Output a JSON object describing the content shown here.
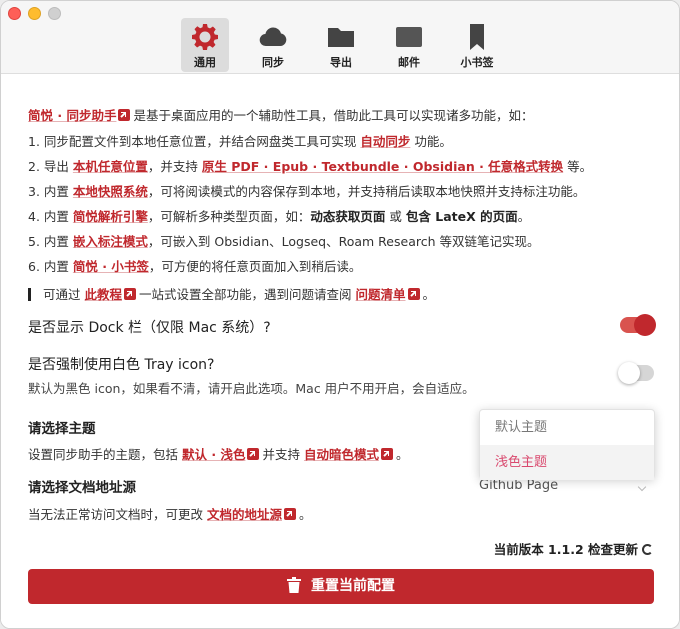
{
  "tabs": [
    {
      "label": "通用",
      "icon": "gear-icon",
      "active": true
    },
    {
      "label": "同步",
      "icon": "cloud-icon"
    },
    {
      "label": "导出",
      "icon": "folder-icon"
    },
    {
      "label": "邮件",
      "icon": "mail-icon"
    },
    {
      "label": "小书签",
      "icon": "bookmark-icon"
    }
  ],
  "intro": {
    "app_name": "简悦 · 同步助手",
    "lead": "是基于桌面应用的一个辅助性工具，借助此工具可以实现诸多功能，如：",
    "l1a": "1. 同步配置文件到本地任意位置，并结合网盘类工具可实现",
    "l1b": "自动同步",
    "l1c": "功能。",
    "l2a": "2. 导出",
    "l2b": "本机任意位置",
    "l2c": "，并支持",
    "l2d": "原生 PDF · Epub · Textbundle · Obsidian · 任意格式转换",
    "l2e": "等。",
    "l3a": "3. 内置",
    "l3b": "本地快照系统",
    "l3c": "，可将阅读模式的内容保存到本地，并支持稍后读取本地快照并支持标注功能。",
    "l4a": "4. 内置",
    "l4b": "简悦解析引擎",
    "l4c": "，可解析多种类型页面，如：",
    "l4d": "动态获取页面",
    "l4e": "或",
    "l4f": "包含 LateX 的页面",
    "l4g": "。",
    "l5a": "5. 内置",
    "l5b": "嵌入标注模式",
    "l5c": "，可嵌入到 Obsidian、Logseq、Roam Research 等双链笔记实现。",
    "l6a": "6. 内置",
    "l6b": "简悦 · 小书签",
    "l6c": "，可方便的将任意页面加入到稍后读。",
    "tip_a": "可通过",
    "tip_b": "此教程",
    "tip_c": "一站式设置全部功能，遇到问题请查阅",
    "tip_d": "问题清单",
    "tip_e": "。"
  },
  "settings": {
    "dock_label": "是否显示 Dock 栏（仅限 Mac 系统）?",
    "dock_on": true,
    "tray_label": "是否强制使用白色 Tray icon?",
    "tray_desc": "默认为黑色 icon，如果看不清，请开启此选项。Mac 用户不用开启，会自适应。",
    "tray_on": false,
    "theme_title": "请选择主题",
    "theme_desc_a": "设置同步助手的主题，包括",
    "theme_desc_b": "默认 · 浅色",
    "theme_desc_c": "并支持",
    "theme_desc_d": "自动暗色模式",
    "theme_desc_e": "。",
    "theme_options": [
      "默认主题",
      "浅色主题"
    ],
    "theme_selected": "浅色主题",
    "doc_title": "请选择文档地址源",
    "doc_desc_a": "当无法正常访问文档时，可更改",
    "doc_desc_b": "文档的地址源",
    "doc_desc_c": "。",
    "doc_value": "Github Page"
  },
  "footer": {
    "version": "当前版本 1.1.2 检查更新",
    "reset": "重置当前配置"
  },
  "colors": {
    "accent": "#c0282d",
    "selected_option": "#d9496e"
  }
}
